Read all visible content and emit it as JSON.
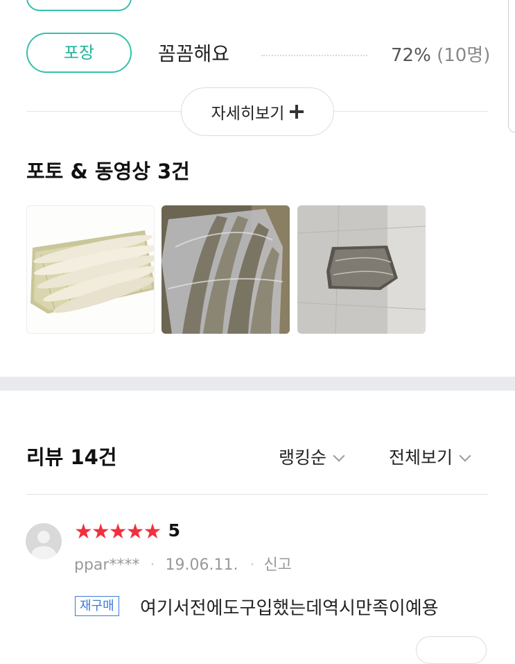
{
  "survey": {
    "item_tag": "포장",
    "item_answer": "꼼꼼해요",
    "item_percent": "72%",
    "item_count": "(10명)"
  },
  "more_button": {
    "label": "자세히보기"
  },
  "photos": {
    "title": "포토 & 동영상 3건"
  },
  "reviews": {
    "title": "리뷰 14건",
    "sort_label": "랭킹순",
    "filter_label": "전체보기",
    "items": [
      {
        "stars": "★★★★★",
        "rating": "5",
        "user": "ppar****",
        "date": "19.06.11.",
        "report": "신고",
        "badge": "재구매",
        "text": "여기서전에도구입했는데역시만족이예용"
      }
    ]
  },
  "colors": {
    "accent": "#34c0a8",
    "star": "#f0303e",
    "badge_blue": "#3a7bd5"
  }
}
